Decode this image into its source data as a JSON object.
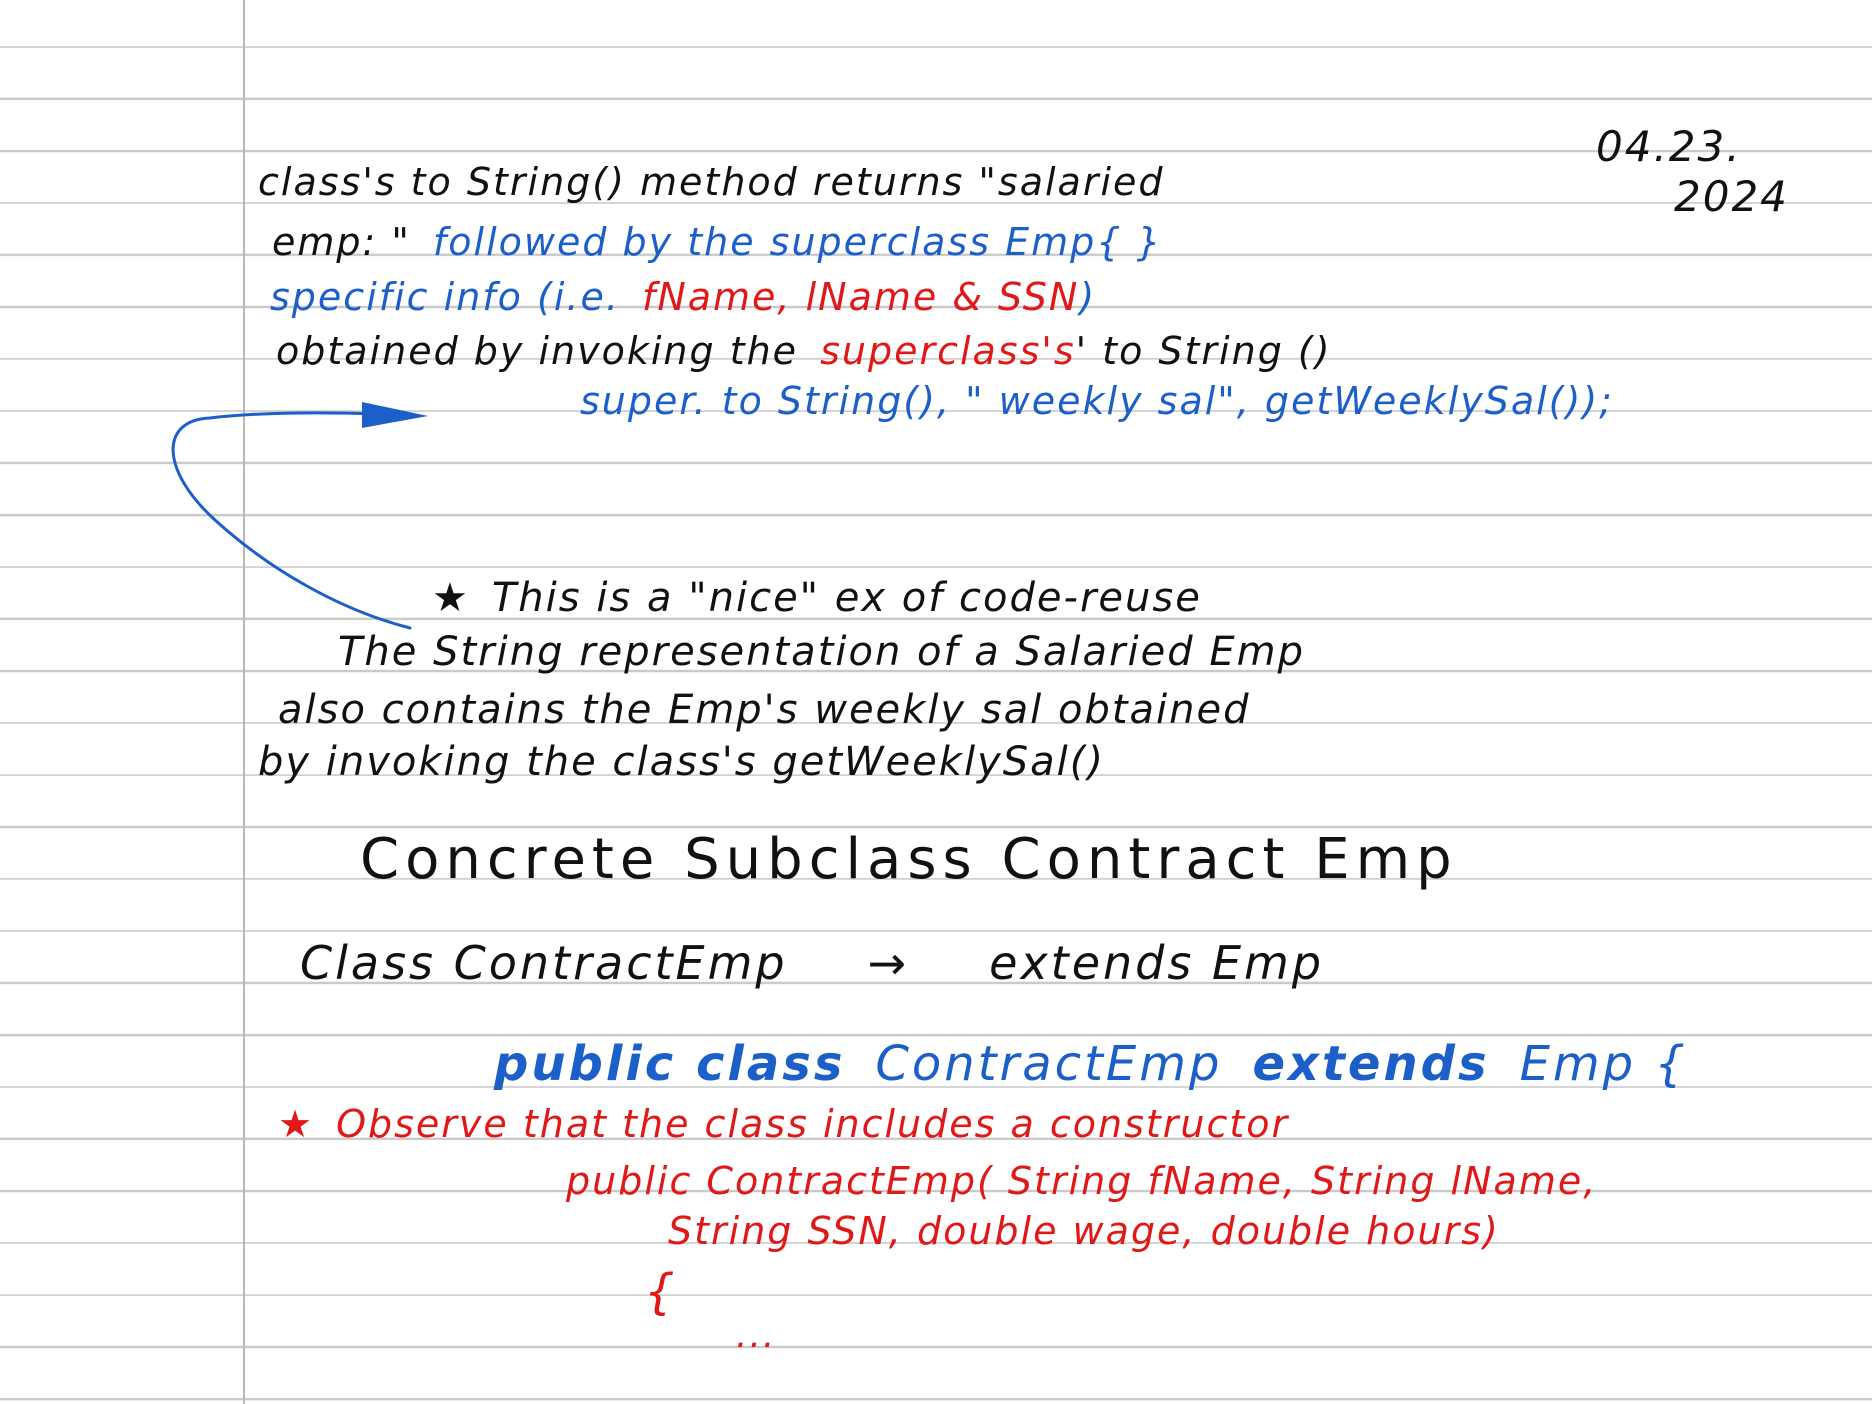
{
  "date": {
    "line1": "04.23.",
    "line2": "2024"
  },
  "lines": {
    "l1": "class's  to String()  method  returns  \"salaried",
    "l2_a": "emp: \"",
    "l2_b": "followed  by  the  superclass  Emp{ }",
    "l3_a": "specific  info  (i.e.",
    "l3_b": "fName,  lName  &  SSN",
    "l3_c": ")",
    "l4_a": "obtained  by  invoking  the",
    "l4_b": "superclass's",
    "l4_c": "'  to String ()",
    "l5": "super. to String(),  \" weekly sal\", getWeeklySal());",
    "l6_star": "★",
    "l6": "This  is  a  \"nice\"  ex  of  code-reuse",
    "l7": "The  String  representation  of  a  Salaried Emp",
    "l8": "also  contains  the  Emp's  weekly  sal  obtained",
    "l9": "by  invoking  the  class's  getWeeklySal()",
    "heading": "Concrete  Subclass  Contract Emp",
    "l11_a": "Class  ContractEmp",
    "l11_arrow": "→",
    "l11_b": "extends  Emp",
    "l12_a": "public class",
    "l12_b": "ContractEmp",
    "l12_c": "extends",
    "l12_d": "Emp {",
    "l13_star": "★",
    "l13": "Observe  that  the  class  includes  a  constructor",
    "l14": "public  ContractEmp( String fName,  String  lName,",
    "l15": "String  SSN,  double  wage,  double  hours)",
    "l16": "{",
    "l17": "..."
  },
  "colors": {
    "black_ink": "#111111",
    "blue_ink": "#1d5fc9",
    "red_ink": "#e01818",
    "rule_line": "#c9c9c9"
  }
}
